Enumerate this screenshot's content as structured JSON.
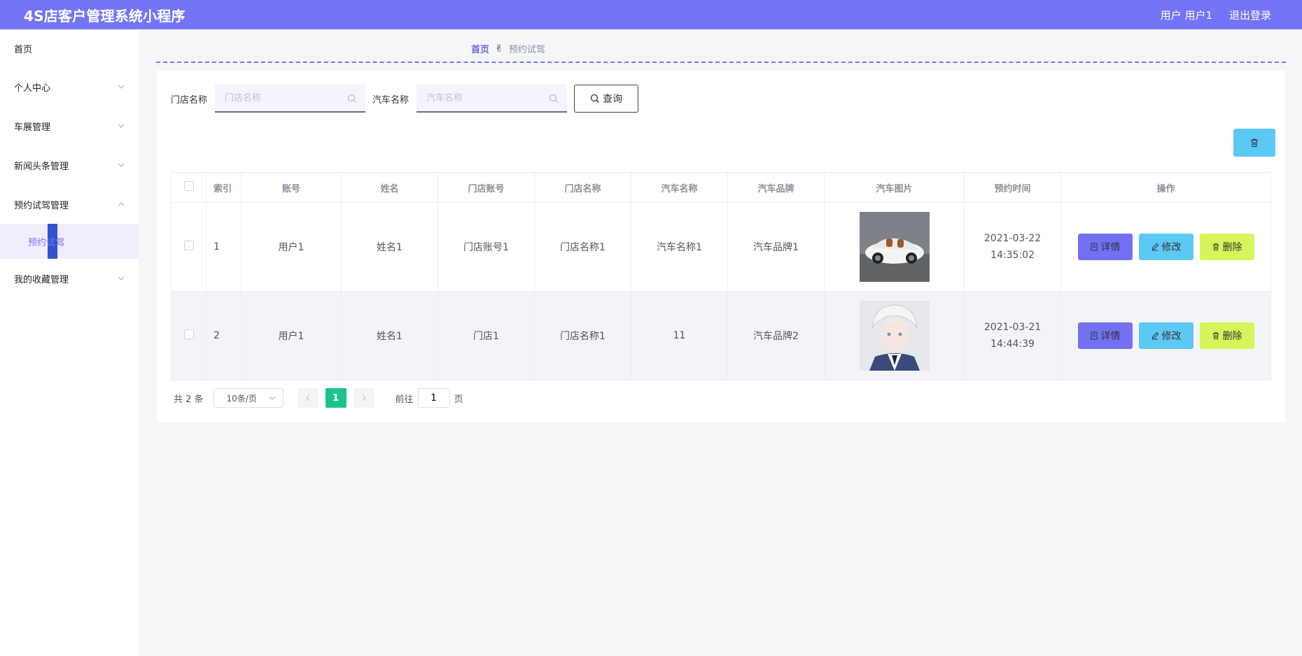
{
  "header": {
    "app_title": "4S店客户管理系统小程序",
    "user_label": "用户 用户1",
    "logout_label": "退出登录"
  },
  "sidebar": {
    "items": [
      {
        "label": "首页",
        "has_chevron": false
      },
      {
        "label": "个人中心",
        "has_chevron": true
      },
      {
        "label": "车展管理",
        "has_chevron": true
      },
      {
        "label": "新闻头条管理",
        "has_chevron": true
      },
      {
        "label": "预约试驾管理",
        "has_chevron": true,
        "expanded": true
      }
    ],
    "sub_item": "预约试驾",
    "last_item": "我的收藏管理"
  },
  "breadcrumb": {
    "home": "首页",
    "icon": "hand-icon",
    "current": "预约试驾"
  },
  "search": {
    "store_label": "门店名称",
    "store_placeholder": "门店名称",
    "car_label": "汽车名称",
    "car_placeholder": "汽车名称",
    "query_label": "查询"
  },
  "table": {
    "headers": [
      "索引",
      "账号",
      "姓名",
      "门店账号",
      "门店名称",
      "汽车名称",
      "汽车品牌",
      "汽车图片",
      "预约时间",
      "操作"
    ],
    "rows": [
      {
        "index": "1",
        "account": "用户1",
        "name": "姓名1",
        "store_account": "门店账号1",
        "store_name": "门店名称1",
        "car_name": "汽车名称1",
        "brand": "汽车品牌1",
        "image": "white-sports-car",
        "time": "2021-03-22 14:35:02"
      },
      {
        "index": "2",
        "account": "用户1",
        "name": "姓名1",
        "store_account": "门店1",
        "store_name": "门店名称1",
        "car_name": "11",
        "brand": "汽车品牌2",
        "image": "anime-portrait",
        "time": "2021-03-21 14:44:39"
      }
    ],
    "actions": {
      "detail": "详情",
      "edit": "修改",
      "delete": "删除"
    }
  },
  "pagination": {
    "total": "共 2 条",
    "page_size": "10条/页",
    "current_page": "1",
    "goto_prefix": "前往",
    "goto_value": "1",
    "goto_suffix": "页"
  },
  "colors": {
    "header": "#7474f7",
    "detail": "#7370f4",
    "edit": "#5cc8f4",
    "delete": "#d6f55a",
    "active_page": "#1cc48d"
  }
}
